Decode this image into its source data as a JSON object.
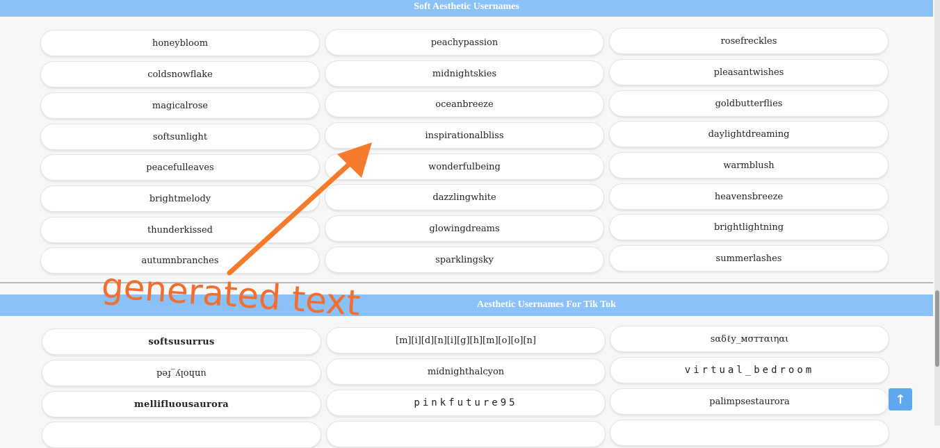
{
  "section1": {
    "title": "Soft Aesthetic Usernames",
    "col1": [
      "honeybloom",
      "coldsnowflake",
      "magicalrose",
      "softsunlight",
      "peacefulleaves",
      "brightmelody",
      "thunderkissed",
      "autumnbranches"
    ],
    "col2": [
      "peachypassion",
      "midnightskies",
      "oceanbreeze",
      "inspirationalbliss",
      "wonderfulbeing",
      "dazzlingwhite",
      "glowingdreams",
      "sparklingsky"
    ],
    "col3": [
      "rosefreckles",
      "pleasantwishes",
      "goldbutterflies",
      "daylightdreaming",
      "warmblush",
      "heavensbreeze",
      "brightlightning",
      "summerlashes"
    ]
  },
  "section2": {
    "title": "Aesthetic Usernames For Tik Tok",
    "row1": [
      "softsusurrus",
      "[m][i][d][n][i][g][h][m][o][o][n]",
      "sαδℓу_мσттαιηαι"
    ],
    "row2": [
      "unholy_fed",
      "midnighthalcyon",
      "virtual_bedroom"
    ],
    "row3": [
      "mellifluousaurora",
      "pinkfuture95",
      "palimpsestaurora"
    ]
  },
  "overlay": {
    "text": "generated text"
  },
  "back_to_top": {
    "icon": "arrow-up-icon",
    "glyph": "↑"
  },
  "colors": {
    "header": "#8ac1f7",
    "accent": "#f26d2e",
    "button": "#5fa7ee"
  }
}
